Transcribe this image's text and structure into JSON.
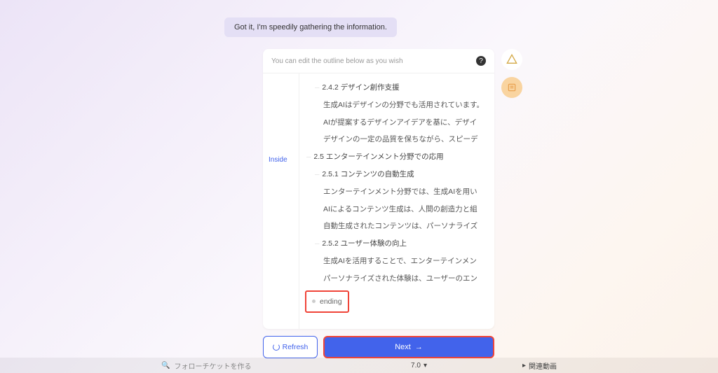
{
  "chat": {
    "bubble": "Got it, I'm speedily gathering the information."
  },
  "panel": {
    "header_text": "You can edit the outline below as you wish",
    "sidebar_label": "Inside",
    "ending_label": "ending"
  },
  "outline": {
    "items": [
      {
        "level": 3,
        "text": "2.4.2 デザイン創作支援"
      },
      {
        "level": 4,
        "text": "生成AIはデザインの分野でも活用されています。"
      },
      {
        "level": 4,
        "text": "AIが提案するデザインアイデアを基に、デザイ"
      },
      {
        "level": 4,
        "text": "デザインの一定の品質を保ちながら、スピーデ"
      },
      {
        "level": 2,
        "text": "2.5 エンターテインメント分野での応用"
      },
      {
        "level": 3,
        "text": "2.5.1 コンテンツの自動生成"
      },
      {
        "level": 4,
        "text": "エンターテインメント分野では、生成AIを用い"
      },
      {
        "level": 4,
        "text": "AIによるコンテンツ生成は、人間の創造力と組"
      },
      {
        "level": 4,
        "text": "自動生成されたコンテンツは、パーソナライズ"
      },
      {
        "level": 3,
        "text": "2.5.2 ユーザー体験の向上"
      },
      {
        "level": 4,
        "text": "生成AIを活用することで、エンターテインメン"
      },
      {
        "level": 4,
        "text": "パーソナライズされた体験は、ユーザーのエン"
      }
    ]
  },
  "buttons": {
    "refresh": "Refresh",
    "next": "Next"
  },
  "bottom": {
    "search_placeholder": "フォローチケットを作る",
    "zoom": "7.0",
    "related": "関連動画"
  }
}
